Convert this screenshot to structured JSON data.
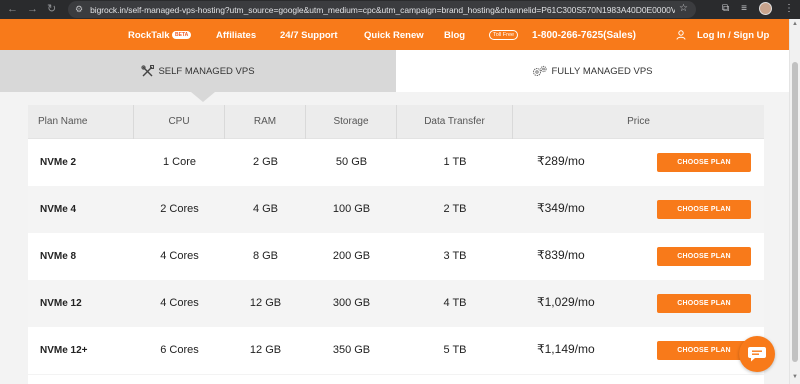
{
  "browser": {
    "url": "bigrock.in/self-managed-vps-hosting?utm_source=google&utm_medium=cpc&utm_campaign=brand_hosting&channelid=P61C300S570N1983A40D0E0000V...",
    "icons": [
      "back-icon",
      "forward-icon",
      "reload-icon",
      "tune-icon",
      "star-icon",
      "extensions-icon",
      "reading-list-icon",
      "profile-avatar"
    ]
  },
  "header": {
    "nav": [
      {
        "label": "RockTalk"
      },
      {
        "label": "Affiliates"
      },
      {
        "label": "24/7 Support"
      },
      {
        "label": "Quick Renew"
      },
      {
        "label": "Blog"
      }
    ],
    "beta_badge": "BETA",
    "toll_free_badge": "Toll Free",
    "phone": "1-800-266-7625(Sales)",
    "login": "Log In / Sign Up",
    "accent_color": "#f87a1a"
  },
  "tabs": [
    {
      "label": "SELF MANAGED VPS",
      "active": true,
      "icon": "tools-icon"
    },
    {
      "label": "FULLY MANAGED VPS",
      "active": false,
      "icon": "gears-icon"
    }
  ],
  "table": {
    "columns": [
      "Plan Name",
      "CPU",
      "RAM",
      "Storage",
      "Data Transfer",
      "Price"
    ],
    "button_label": "CHOOSE PLAN",
    "rows": [
      {
        "name": "NVMe 2",
        "cpu": "1 Core",
        "ram": "2 GB",
        "storage": "50 GB",
        "transfer": "1 TB",
        "price": "₹289/mo"
      },
      {
        "name": "NVMe 4",
        "cpu": "2 Cores",
        "ram": "4 GB",
        "storage": "100 GB",
        "transfer": "2 TB",
        "price": "₹349/mo"
      },
      {
        "name": "NVMe 8",
        "cpu": "4 Cores",
        "ram": "8 GB",
        "storage": "200 GB",
        "transfer": "3 TB",
        "price": "₹839/mo"
      },
      {
        "name": "NVMe 12",
        "cpu": "4 Cores",
        "ram": "12 GB",
        "storage": "300 GB",
        "transfer": "4 TB",
        "price": "₹1,029/mo"
      },
      {
        "name": "NVMe 12+",
        "cpu": "6 Cores",
        "ram": "12 GB",
        "storage": "350 GB",
        "transfer": "5 TB",
        "price": "₹1,149/mo"
      }
    ]
  },
  "chat": {
    "icon": "chat-bubble-icon"
  }
}
